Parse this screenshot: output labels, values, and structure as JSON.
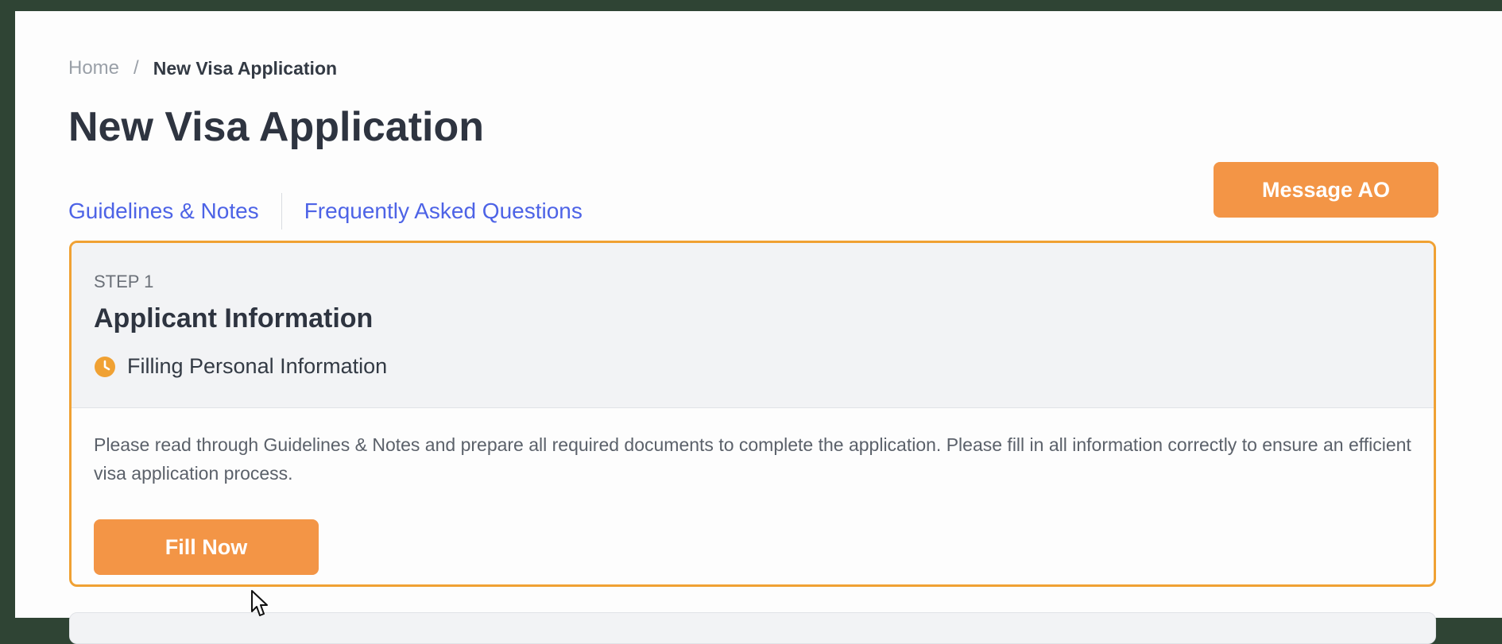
{
  "breadcrumb": {
    "home": "Home",
    "separator": "/",
    "current": "New Visa Application"
  },
  "page": {
    "title": "New Visa Application"
  },
  "links": {
    "guidelines": "Guidelines & Notes",
    "faq": "Frequently Asked Questions"
  },
  "actions": {
    "message_ao": "Message AO"
  },
  "step": {
    "label": "STEP 1",
    "title": "Applicant Information",
    "status": "Filling Personal Information",
    "status_icon": "clock-icon",
    "description": "Please read through Guidelines & Notes and prepare all required documents to complete the application. Please fill in all information correctly to ensure an efficient visa application process.",
    "button": "Fill Now"
  },
  "colors": {
    "accent": "#f39546",
    "card_border": "#f0a133",
    "link": "#4d63e6",
    "background": "#2f4434"
  }
}
